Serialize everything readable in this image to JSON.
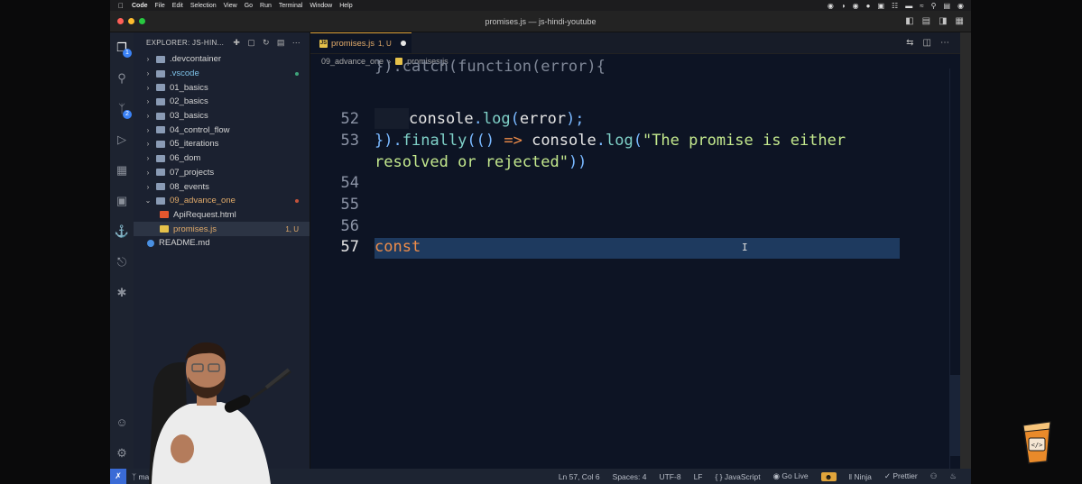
{
  "menubar": {
    "items": [
      "Code",
      "File",
      "Edit",
      "Selection",
      "View",
      "Go",
      "Run",
      "Terminal",
      "Window",
      "Help"
    ]
  },
  "window": {
    "title": "promises.js — js-hindi-youtube"
  },
  "activity_bar": {
    "explorer_badge": "1",
    "scm_badge": "2"
  },
  "explorer": {
    "header": "EXPLORER: JS-HIN...",
    "items": [
      {
        "label": ".devcontainer",
        "type": "folder",
        "status": ""
      },
      {
        "label": ".vscode",
        "type": "folder",
        "status": "dot"
      },
      {
        "label": "01_basics",
        "type": "folder",
        "status": ""
      },
      {
        "label": "02_basics",
        "type": "folder",
        "status": ""
      },
      {
        "label": "03_basics",
        "type": "folder",
        "status": ""
      },
      {
        "label": "04_control_flow",
        "type": "folder",
        "status": ""
      },
      {
        "label": "05_iterations",
        "type": "folder",
        "status": ""
      },
      {
        "label": "06_dom",
        "type": "folder",
        "status": ""
      },
      {
        "label": "07_projects",
        "type": "folder",
        "status": ""
      },
      {
        "label": "08_events",
        "type": "folder",
        "status": ""
      },
      {
        "label": "09_advance_one",
        "type": "folder-open",
        "status": "dot-red"
      },
      {
        "label": "ApiRequest.html",
        "type": "html",
        "status": ""
      },
      {
        "label": "promises.js",
        "type": "js",
        "status": "1, U"
      },
      {
        "label": "README.md",
        "type": "info",
        "status": ""
      }
    ]
  },
  "editor": {
    "tab": {
      "label": "promises.js",
      "status": "1, U"
    },
    "breadcrumb": [
      "09_advance_one",
      "promises.js"
    ],
    "line_numbers": [
      "52",
      "53",
      "54",
      "55",
      "56",
      "57"
    ],
    "line52": {
      "obj": "console",
      "dot": ".",
      "method": "log",
      "open": "(",
      "arg": "error",
      "close": ");"
    },
    "line53": {
      "brace": "})",
      "dot1": ".",
      "finally": "finally",
      "paren_open": "((",
      "arrow_params": ")",
      "arrow": " => ",
      "obj": "console",
      "dot2": ".",
      "method": "log",
      "paren": "(",
      "string": "\"The promise is either"
    },
    "line53_wrap": {
      "string": "resolved or rejected\"",
      "close": "))"
    },
    "line57": {
      "keyword": "const"
    }
  },
  "statusbar": {
    "branch": "ma",
    "position": "Ln 57, Col 6",
    "spaces": "Spaces: 4",
    "encoding": "UTF-8",
    "eol": "LF",
    "language": "JavaScript",
    "golive": "Go Live",
    "ninja": "Ninja",
    "prettier": "Prettier"
  },
  "colors": {
    "accent_tab": "#e0a43b",
    "keyword": "#f08d49",
    "function": "#7fd1c8",
    "string": "#c3e88d",
    "selection": "#1e3a5f"
  }
}
